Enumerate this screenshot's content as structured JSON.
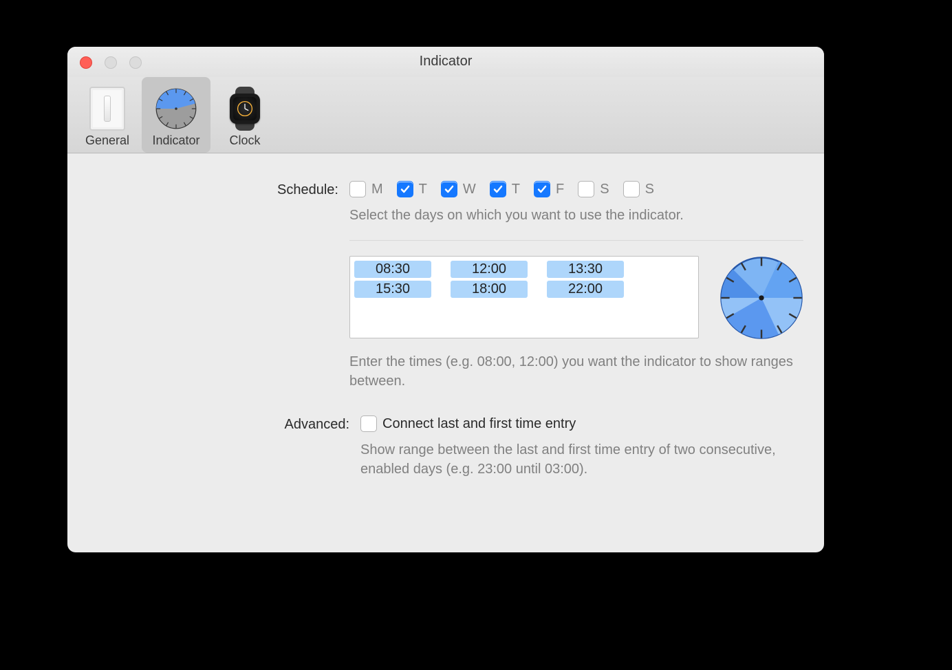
{
  "window": {
    "title": "Indicator"
  },
  "toolbar": {
    "items": [
      {
        "key": "general",
        "label": "General",
        "selected": false
      },
      {
        "key": "indicator",
        "label": "Indicator",
        "selected": true
      },
      {
        "key": "clock",
        "label": "Clock",
        "selected": false
      }
    ]
  },
  "schedule": {
    "label": "Schedule:",
    "days": [
      {
        "letter": "M",
        "checked": false
      },
      {
        "letter": "T",
        "checked": true
      },
      {
        "letter": "W",
        "checked": true
      },
      {
        "letter": "T",
        "checked": true
      },
      {
        "letter": "F",
        "checked": true
      },
      {
        "letter": "S",
        "checked": false
      },
      {
        "letter": "S",
        "checked": false
      }
    ],
    "help": "Select the days on which you want to use the indicator."
  },
  "times": {
    "entries": [
      "08:30",
      "12:00",
      "13:30",
      "15:30",
      "18:00",
      "22:00"
    ],
    "help": "Enter the times (e.g. 08:00, 12:00) you want the indicator to show ranges between."
  },
  "advanced": {
    "label": "Advanced:",
    "connect_label": "Connect last and first time entry",
    "connect_checked": false,
    "help": "Show range between the last and first time entry of two consecutive, enabled days (e.g. 23:00 until 03:00)."
  }
}
